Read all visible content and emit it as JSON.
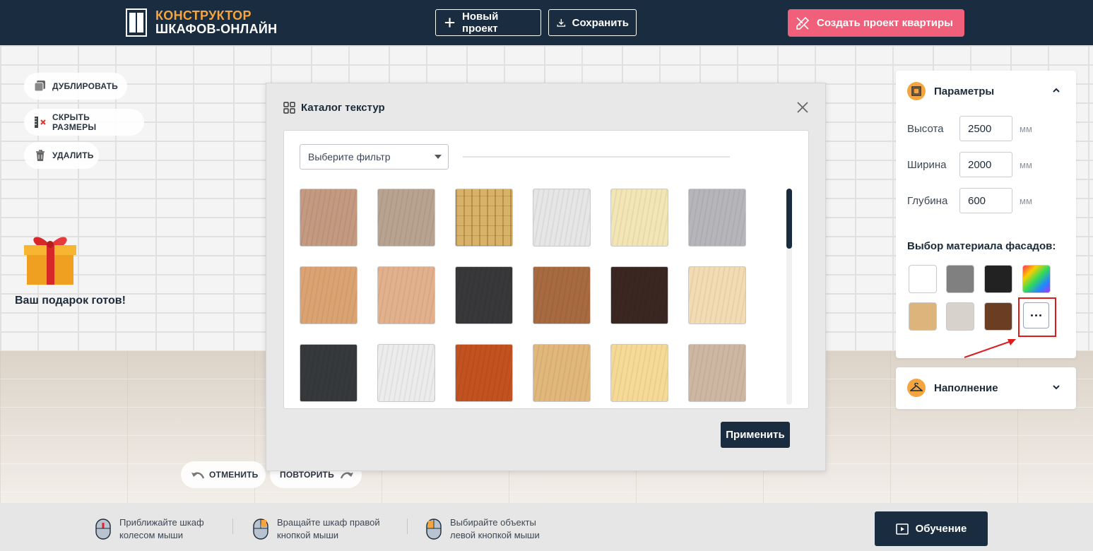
{
  "header": {
    "logo_line1": "КОНСТРУКТОР",
    "logo_line2": "ШКАФОВ-ОНЛАЙН",
    "new_project": "Новый проект",
    "save": "Сохранить",
    "apartment_project": "Создать проект квартиры",
    "accent_color": "#f5a540",
    "bg_color": "#1a2c3f",
    "apartment_color": "#f0607a"
  },
  "tools": {
    "duplicate": "ДУБЛИРОВАТЬ",
    "hide_sizes": "СКРЫТЬ РАЗМЕРЫ",
    "delete": "УДАЛИТЬ",
    "undo": "ОТМЕНИТЬ",
    "redo": "ПОВТОРИТЬ"
  },
  "gift": {
    "text": "Ваш подарок готов!"
  },
  "catalog": {
    "title": "Каталог текстур",
    "filter_placeholder": "Выберите фильтр",
    "apply": "Применить",
    "textures": [
      "#c49a80",
      "#b8a290",
      "#d9b26a",
      "#e6e6e6",
      "#f2e6b5",
      "#b5b5ba",
      "#dca372",
      "#e2b18c",
      "#38383a",
      "#a86a40",
      "#3b2722",
      "#f3dcb3",
      "#35393c",
      "#ececec",
      "#c2521f",
      "#e2b77b",
      "#f5d996",
      "#cdb7a2"
    ]
  },
  "params": {
    "title": "Параметры",
    "height_label": "Высота",
    "height": "2500",
    "width_label": "Ширина",
    "width": "2000",
    "depth_label": "Глубина",
    "depth": "600",
    "unit": "мм",
    "material_title": "Выбор материала фасадов:",
    "swatches": [
      "#ffffff",
      "#808080",
      "#222222",
      "rainbow",
      "#dcb47c",
      "#d7d2cc",
      "#6b3d22"
    ]
  },
  "filling": {
    "title": "Наполнение"
  },
  "footer": {
    "hint1_l1": "Приближайте шкаф",
    "hint1_l2": "колесом мыши",
    "hint2_l1": "Вращайте шкаф правой",
    "hint2_l2": "кнопкой мыши",
    "hint3_l1": "Выбирайте объекты",
    "hint3_l2": "левой кнопкой мыши",
    "learn": "Обучение"
  }
}
